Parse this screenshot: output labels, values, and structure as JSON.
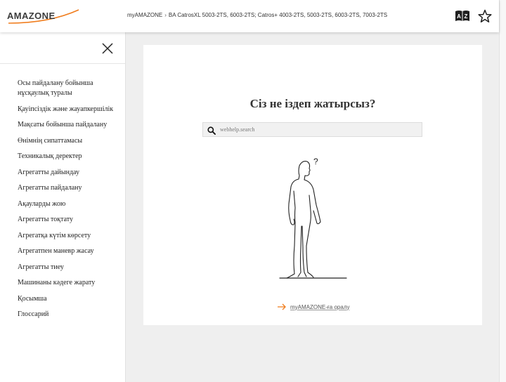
{
  "header": {
    "logo_alt": "AMAZONE",
    "logo_text": "AMAZONE",
    "breadcrumb": [
      "myAMAZONE",
      "BA CatrosXL 5003-2TS, 6003-2TS; Catros+ 4003-2TS, 5003-2TS, 6003-2TS, 7003-2TS"
    ],
    "breadcrumb_separator": "›",
    "language_icon": "language-book-icon",
    "favorite_icon": "star-icon"
  },
  "sidebar": {
    "close_icon": "close-icon",
    "items": [
      "Осы пайдалану бойынша нұсқаулық туралы",
      "Қауіпсіздік және жауапкершілік",
      "Мақсаты бойынша пайдалану",
      "Өнімнің сипаттамасы",
      "Техникалық деректер",
      "Агрегатты дайындау",
      "Агрегатты пайдалану",
      "Ақауларды жою",
      "Агрегатты тоқтату",
      "Агрегатқа күтім көрсету",
      "Агрегатпен маневр жасау",
      "Агрегатты тиеу",
      "Машинаны кәдеге жарату",
      "Қосымша",
      "Глоссарий"
    ]
  },
  "main": {
    "title": "Сіз не іздеп жатырсыз?",
    "search_placeholder": "webhelp.search",
    "search_value": "",
    "illustration_mark": "?",
    "back_link_label": "myAMAZONE-ға оралу"
  },
  "colors": {
    "accent": "#f07d1e",
    "header_bg": "#ffffff",
    "page_bg": "#efefef",
    "text": "#222222"
  }
}
